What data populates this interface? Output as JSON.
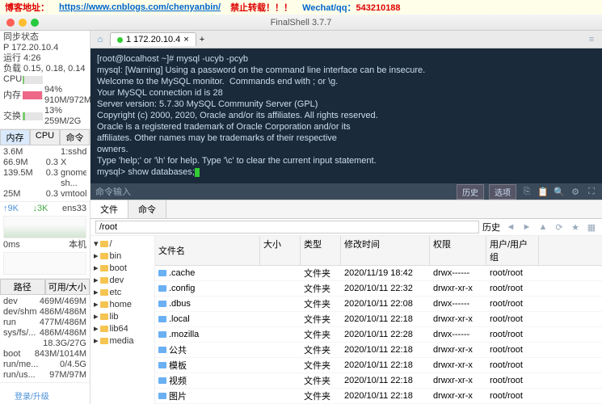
{
  "banner": {
    "blog_label": "博客地址：",
    "blog_url": "https://www.cnblogs.com/chenyanbin/",
    "forbid": "禁止转载！！！",
    "contact": "Wechat/qq：",
    "contact_id": "543210188"
  },
  "title": "FinalShell 3.7.7",
  "tab": {
    "label": "1 172.20.10.4",
    "close": "×",
    "add": "+"
  },
  "sidebar": {
    "sync_label": "同步状态",
    "ip_label": "P 172.20.10.4",
    "runtime_label": "运行 4:26",
    "load_label": "负载 0.15, 0.18, 0.14",
    "cpu": {
      "label": "CPU",
      "pct": "",
      "detail": ""
    },
    "mem": {
      "label": "内存",
      "pct": "94%",
      "detail": "910M/972M"
    },
    "swap": {
      "label": "交换",
      "pct": "13%",
      "detail": "259M/2G"
    },
    "tabs": {
      "tab1": "内存",
      "tab2": "CPU",
      "tab3": "命令"
    },
    "procs": [
      {
        "mem": "3.6M",
        "cpu": "",
        "name": "1:sshd"
      },
      {
        "mem": "66.9M",
        "cpu": "0.3",
        "name": "X"
      },
      {
        "mem": "139.5M",
        "cpu": "0.3",
        "name": "gnome-sh..."
      },
      {
        "mem": "25M",
        "cpu": "0.3",
        "name": "vmtoolsd"
      }
    ],
    "net": {
      "up": "9K",
      "down": "3K",
      "gw": "ens33"
    },
    "latency": "0ms",
    "host": "本机",
    "disk_hdr": {
      "path": "路径",
      "avail": "可用/大小"
    },
    "disks": [
      {
        "p": "dev",
        "s": "469M/469M"
      },
      {
        "p": "dev/shm",
        "s": "486M/486M"
      },
      {
        "p": "run",
        "s": "477M/486M"
      },
      {
        "p": "sys/fs/...",
        "s": "486M/486M"
      },
      {
        "p": "",
        "s": "18.3G/27G"
      },
      {
        "p": "boot",
        "s": "843M/1014M"
      },
      {
        "p": "run/me...",
        "s": "0/4.5G"
      },
      {
        "p": "run/us...",
        "s": "97M/97M"
      }
    ]
  },
  "terminal": {
    "lines": [
      "[root@localhost ~]# mysql -ucyb -pcyb",
      "mysql: [Warning] Using a password on the command line interface can be insecure.",
      "Welcome to the MySQL monitor.  Commands end with ; or \\g.",
      "Your MySQL connection id is 28",
      "Server version: 5.7.30 MySQL Community Server (GPL)",
      "",
      "Copyright (c) 2000, 2020, Oracle and/or its affiliates. All rights reserved.",
      "",
      "Oracle is a registered trademark of Oracle Corporation and/or its",
      "affiliates. Other names may be trademarks of their respective",
      "owners.",
      "",
      "Type 'help;' or '\\h' for help. Type '\\c' to clear the current input statement.",
      ""
    ],
    "prompt": "mysql> ",
    "current_cmd": "show databases;",
    "footer_label": "命令输入",
    "btn_history": "历史",
    "btn_options": "选项"
  },
  "files": {
    "tab1": "文件",
    "tab2": "命令",
    "path": "/root",
    "btn_history": "历史",
    "tree": [
      "/",
      "bin",
      "boot",
      "dev",
      "etc",
      "home",
      "lib",
      "lib64",
      "media"
    ],
    "headers": {
      "name": "文件名",
      "size": "大小",
      "type": "类型",
      "date": "修改时间",
      "perm": "权限",
      "user": "用户/用户组"
    },
    "rows": [
      {
        "name": ".cache",
        "type": "文件夹",
        "date": "2020/11/19 18:42",
        "perm": "drwx------",
        "user": "root/root"
      },
      {
        "name": ".config",
        "type": "文件夹",
        "date": "2020/10/11 22:32",
        "perm": "drwxr-xr-x",
        "user": "root/root"
      },
      {
        "name": ".dbus",
        "type": "文件夹",
        "date": "2020/10/11 22:08",
        "perm": "drwx------",
        "user": "root/root"
      },
      {
        "name": ".local",
        "type": "文件夹",
        "date": "2020/10/11 22:18",
        "perm": "drwxr-xr-x",
        "user": "root/root"
      },
      {
        "name": ".mozilla",
        "type": "文件夹",
        "date": "2020/10/11 22:28",
        "perm": "drwx------",
        "user": "root/root"
      },
      {
        "name": "公共",
        "type": "文件夹",
        "date": "2020/10/11 22:18",
        "perm": "drwxr-xr-x",
        "user": "root/root"
      },
      {
        "name": "模板",
        "type": "文件夹",
        "date": "2020/10/11 22:18",
        "perm": "drwxr-xr-x",
        "user": "root/root"
      },
      {
        "name": "视频",
        "type": "文件夹",
        "date": "2020/10/11 22:18",
        "perm": "drwxr-xr-x",
        "user": "root/root"
      },
      {
        "name": "图片",
        "type": "文件夹",
        "date": "2020/10/11 22:18",
        "perm": "drwxr-xr-x",
        "user": "root/root"
      }
    ]
  },
  "upgrade": "登录/升级"
}
